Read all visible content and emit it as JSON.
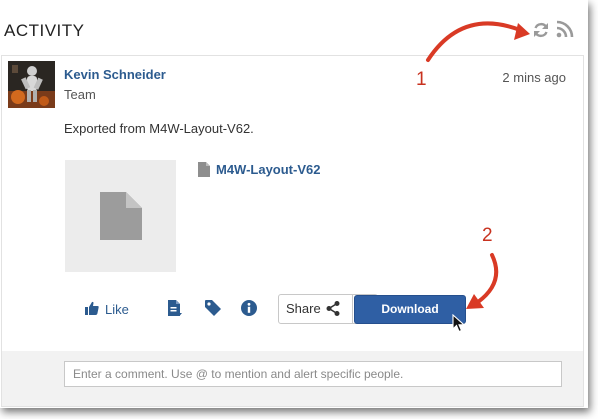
{
  "panel": {
    "title": "ACTIVITY",
    "refresh_icon": "refresh-icon",
    "rss_icon": "rss-feed-icon"
  },
  "post": {
    "author": "Kevin Schneider",
    "group": "Team",
    "time": "2 mins ago",
    "message": "Exported from M4W-Layout-V62.",
    "attachment_name": "M4W-Layout-V62"
  },
  "actions": {
    "like_label": "Like",
    "share_label": "Share",
    "download_label": "Download",
    "icons": [
      "thumbs-up-icon",
      "document-icon",
      "tag-icon",
      "info-icon",
      "share-icon",
      "caret-down-icon"
    ]
  },
  "comment": {
    "placeholder": "Enter a comment. Use @ to mention and alert specific people."
  },
  "annotations": {
    "callout_1": "1",
    "callout_2": "2",
    "arrow_color": "#d93a25"
  },
  "colors": {
    "link": "#2c5b8f",
    "primary_button": "#2f5fa4",
    "comment_bg": "#f2f2f2"
  }
}
